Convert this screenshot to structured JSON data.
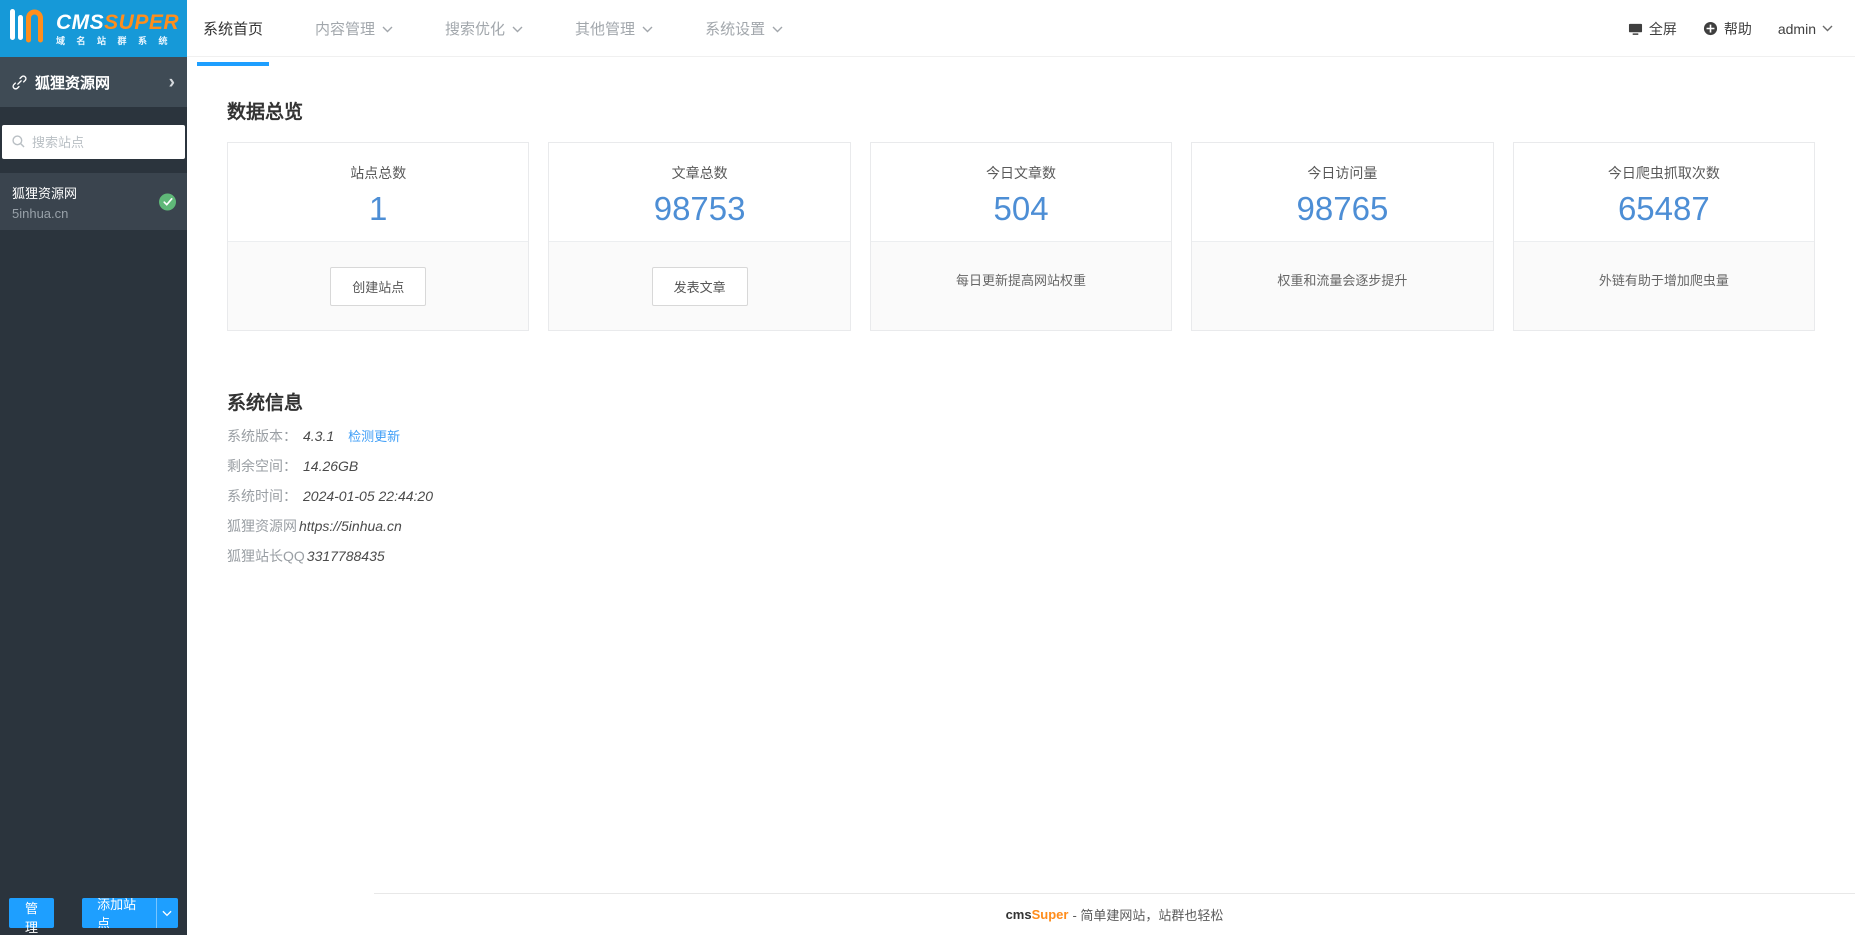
{
  "header": {
    "logo": {
      "cms": "CMS",
      "super": "SUPER",
      "subtitle": "域 名 站 群 系 统"
    },
    "tabs": [
      {
        "label": "系统首页"
      },
      {
        "label": "内容管理"
      },
      {
        "label": "搜索优化"
      },
      {
        "label": "其他管理"
      },
      {
        "label": "系统设置"
      }
    ],
    "fullscreen_label": "全屏",
    "help_label": "帮助",
    "username": "admin"
  },
  "sidebar": {
    "site_title": "狐狸资源网",
    "search_placeholder": "搜索站点",
    "site": {
      "name": "狐狸资源网",
      "domain": "5inhua.cn",
      "status": "online"
    },
    "manage_label": "管理",
    "add_site_label": "添加站点"
  },
  "overview": {
    "title": "数据总览",
    "cards": [
      {
        "title": "站点总数",
        "value": "1",
        "action": "创建站点"
      },
      {
        "title": "文章总数",
        "value": "98753",
        "action": "发表文章"
      },
      {
        "title": "今日文章数",
        "value": "504",
        "note": "每日更新提高网站权重"
      },
      {
        "title": "今日访问量",
        "value": "98765",
        "note": "权重和流量会逐步提升"
      },
      {
        "title": "今日爬虫抓取次数",
        "value": "65487",
        "note": "外链有助于增加爬虫量"
      }
    ]
  },
  "system_info": {
    "title": "系统信息",
    "rows": [
      {
        "label": "系统版本：",
        "value": "4.3.1",
        "link": "检测更新"
      },
      {
        "label": "剩余空间：",
        "value": "14.26GB"
      },
      {
        "label": "系统时间：",
        "value": "2024-01-05 22:44:20"
      },
      {
        "label": "狐狸资源网",
        "value": "https://5inhua.cn"
      },
      {
        "label": "狐狸站长QQ",
        "value": "3317788435"
      }
    ]
  },
  "footer": {
    "brand_cms": "cms",
    "brand_super": "Super",
    "tagline": "- 简单建网站，站群也轻松"
  },
  "colors": {
    "accent_blue": "#1e9fff",
    "logo_bg": "#1699d8",
    "brand_orange": "#ff8e1c",
    "number_blue": "#4d8ed5",
    "success_green": "#5FB878",
    "sidebar_bg": "#2b343d"
  }
}
